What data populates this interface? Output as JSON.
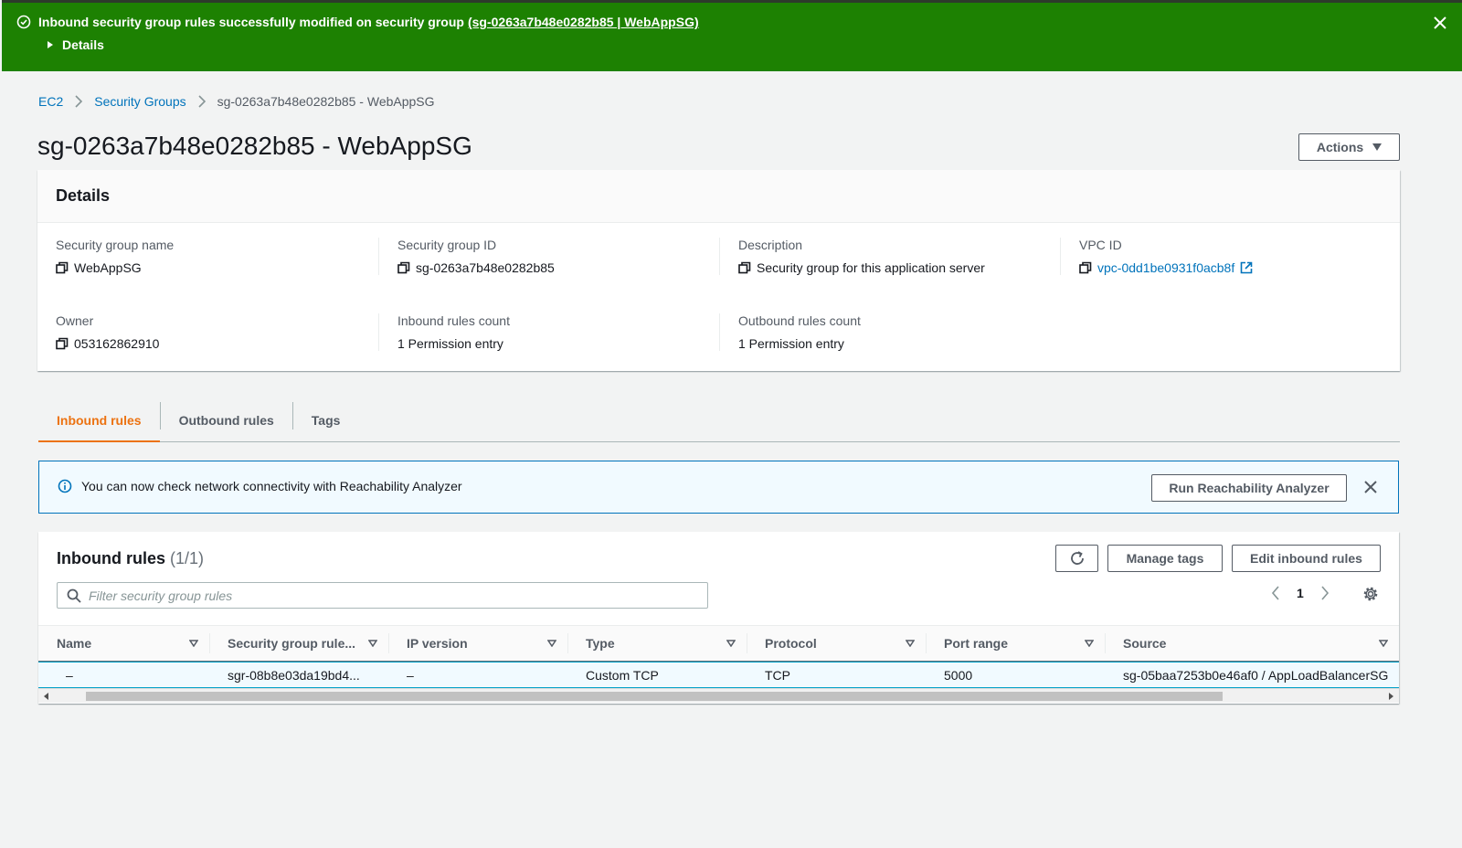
{
  "flash": {
    "message": "Inbound security group rules successfully modified on security group ",
    "link": "(sg-0263a7b48e0282b85 | WebAppSG)",
    "details_label": "Details",
    "color": "#1d8102"
  },
  "breadcrumb": {
    "items": [
      "EC2",
      "Security Groups",
      "sg-0263a7b48e0282b85 - WebAppSG"
    ]
  },
  "page": {
    "title": "sg-0263a7b48e0282b85 - WebAppSG",
    "actions_label": "Actions"
  },
  "details": {
    "header": "Details",
    "fields": [
      {
        "label": "Security group name",
        "value": "WebAppSG"
      },
      {
        "label": "Security group ID",
        "value": "sg-0263a7b48e0282b85"
      },
      {
        "label": "Description",
        "value": "Security group for this application server"
      },
      {
        "label": "VPC ID",
        "value": "vpc-0dd1be0931f0acb8f"
      },
      {
        "label": "Owner",
        "value": "053162862910"
      },
      {
        "label": "Inbound rules count",
        "value": "1 Permission entry"
      },
      {
        "label": "Outbound rules count",
        "value": "1 Permission entry"
      }
    ]
  },
  "tabs": [
    {
      "label": "Inbound rules",
      "active": true
    },
    {
      "label": "Outbound rules",
      "active": false
    },
    {
      "label": "Tags",
      "active": false
    }
  ],
  "info_alert": {
    "message": "You can now check network connectivity with Reachability Analyzer",
    "button_label": "Run Reachability Analyzer"
  },
  "rules": {
    "title": "Inbound rules",
    "count": "(1/1)",
    "manage_tags_label": "Manage tags",
    "edit_label": "Edit inbound rules",
    "filter_placeholder": "Filter security group rules",
    "page_number": "1",
    "columns": [
      "Name",
      "Security group rule...",
      "IP version",
      "Type",
      "Protocol",
      "Port range",
      "Source"
    ],
    "rows": [
      [
        "–",
        "sgr-08b8e03da19bd4...",
        "–",
        "Custom TCP",
        "TCP",
        "5000",
        "sg-05baa7253b0e46af0 / AppLoadBalancerSG"
      ]
    ]
  },
  "colors": {
    "link": "#0073bb",
    "active_tab": "#ec7211",
    "info_border": "#0073bb"
  }
}
